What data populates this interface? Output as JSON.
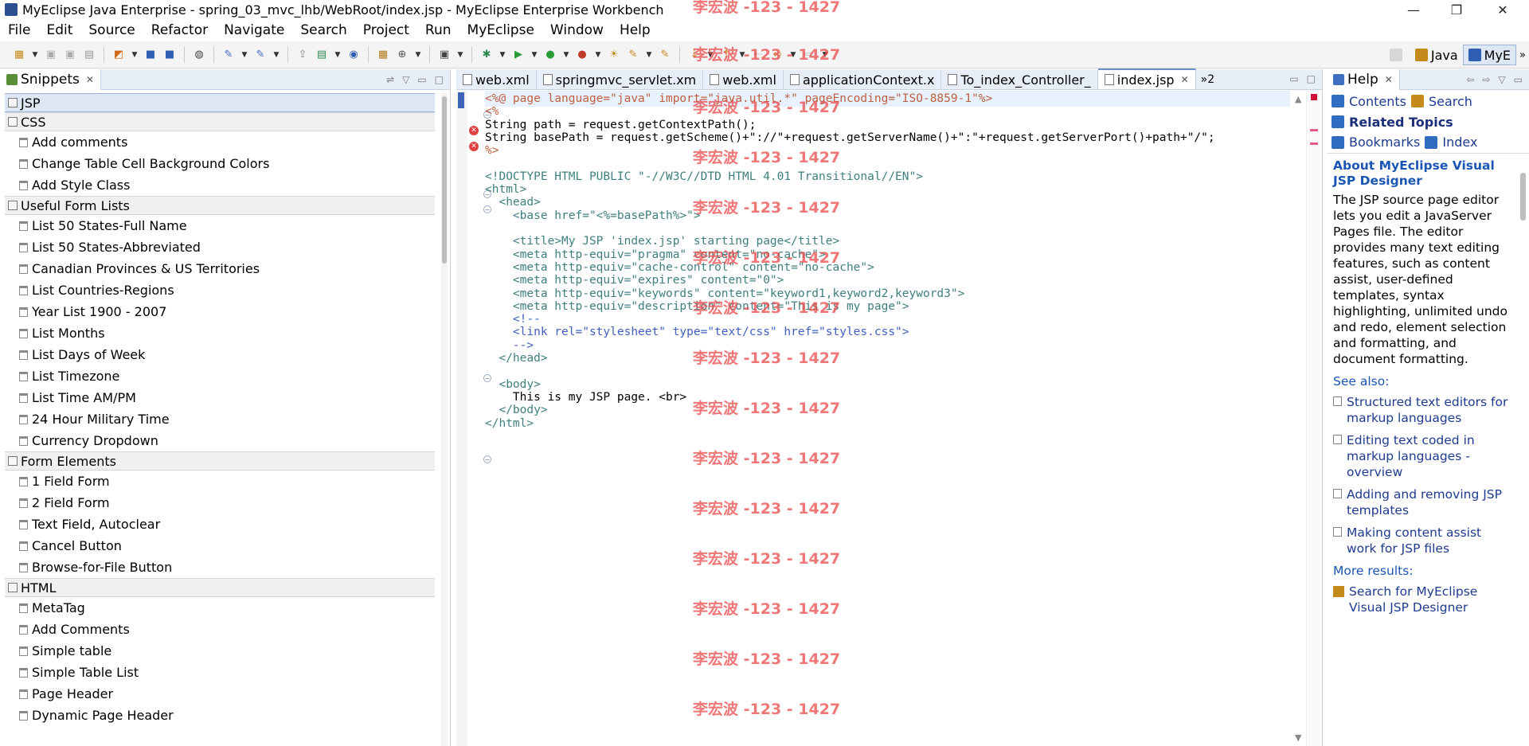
{
  "window": {
    "title": "MyEclipse Java Enterprise - spring_03_mvc_lhb/WebRoot/index.jsp - MyEclipse Enterprise Workbench"
  },
  "menu": [
    "File",
    "Edit",
    "Source",
    "Refactor",
    "Navigate",
    "Search",
    "Project",
    "Run",
    "MyEclipse",
    "Window",
    "Help"
  ],
  "perspectives": [
    {
      "label": "Java",
      "active": false
    },
    {
      "label": "MyE",
      "active": true
    }
  ],
  "snippets": {
    "tab_label": "Snippets",
    "categories": [
      {
        "name": "JSP",
        "items": []
      },
      {
        "name": "CSS",
        "items": [
          "Add comments",
          "Change Table Cell Background Colors",
          "Add Style Class"
        ]
      },
      {
        "name": "Useful Form Lists",
        "items": [
          "List 50 States-Full Name",
          "List 50 States-Abbreviated",
          "Canadian Provinces & US Territories",
          "List Countries-Regions",
          "Year List 1900 - 2007",
          "List Months",
          "List Days of Week",
          "List Timezone",
          "List Time AM/PM",
          "24 Hour Military Time",
          "Currency Dropdown"
        ]
      },
      {
        "name": "Form Elements",
        "items": [
          "1 Field Form",
          "2 Field Form",
          "Text Field, Autoclear",
          "Cancel Button",
          "Browse-for-File Button"
        ]
      },
      {
        "name": "HTML",
        "items": [
          "MetaTag",
          "Add Comments",
          "Simple table",
          "Simple Table List",
          "Page Header",
          "Dynamic Page Header"
        ]
      }
    ]
  },
  "editor": {
    "tabs": [
      {
        "label": "web.xml",
        "active": false
      },
      {
        "label": "springmvc_servlet.xm",
        "active": false
      },
      {
        "label": "web.xml",
        "active": false
      },
      {
        "label": "applicationContext.x",
        "active": false
      },
      {
        "label": "To_index_Controller_",
        "active": false
      },
      {
        "label": "index.jsp",
        "active": true
      }
    ],
    "overflow_count": "»2",
    "lines": [
      "<%@ page language=\"java\" import=\"java.util.*\" pageEncoding=\"ISO-8859-1\"%>",
      "<%",
      "String path = request.getContextPath();",
      "String basePath = request.getScheme()+\"://\"+request.getServerName()+\":\"+request.getServerPort()+path+\"/\";",
      "%>",
      "",
      "<!DOCTYPE HTML PUBLIC \"-//W3C//DTD HTML 4.01 Transitional//EN\">",
      "<html>",
      "  <head>",
      "    <base href=\"<%=basePath%>\">",
      "",
      "    <title>My JSP 'index.jsp' starting page</title>",
      "    <meta http-equiv=\"pragma\" content=\"no-cache\">",
      "    <meta http-equiv=\"cache-control\" content=\"no-cache\">",
      "    <meta http-equiv=\"expires\" content=\"0\">",
      "    <meta http-equiv=\"keywords\" content=\"keyword1,keyword2,keyword3\">",
      "    <meta http-equiv=\"description\" content=\"This is my page\">",
      "    <!--",
      "    <link rel=\"stylesheet\" type=\"text/css\" href=\"styles.css\">",
      "    -->",
      "  </head>",
      "",
      "  <body>",
      "    This is my JSP page. <br>",
      "  </body>",
      "</html>"
    ]
  },
  "help": {
    "tab_label": "Help",
    "toolbar": [
      "Contents",
      "Search"
    ],
    "related_topics": "Related Topics",
    "toolbar2": [
      "Bookmarks",
      "Index"
    ],
    "heading": "About MyEclipse Visual JSP Designer",
    "body": "The JSP source page editor lets you edit a JavaServer Pages file. The editor provides many text editing features, such as content assist, user-defined templates, syntax highlighting, unlimited undo and redo, element selection and formatting, and document formatting.",
    "see_also": "See also:",
    "links": [
      "Structured text editors for markup languages",
      "Editing text coded in markup languages - overview",
      "Adding and removing JSP templates",
      "Making content assist work for JSP files"
    ],
    "more_results": "More results:",
    "search_link": "Search for MyEclipse Visual JSP Designer"
  },
  "watermark": "李宏波 -123 - 1427"
}
